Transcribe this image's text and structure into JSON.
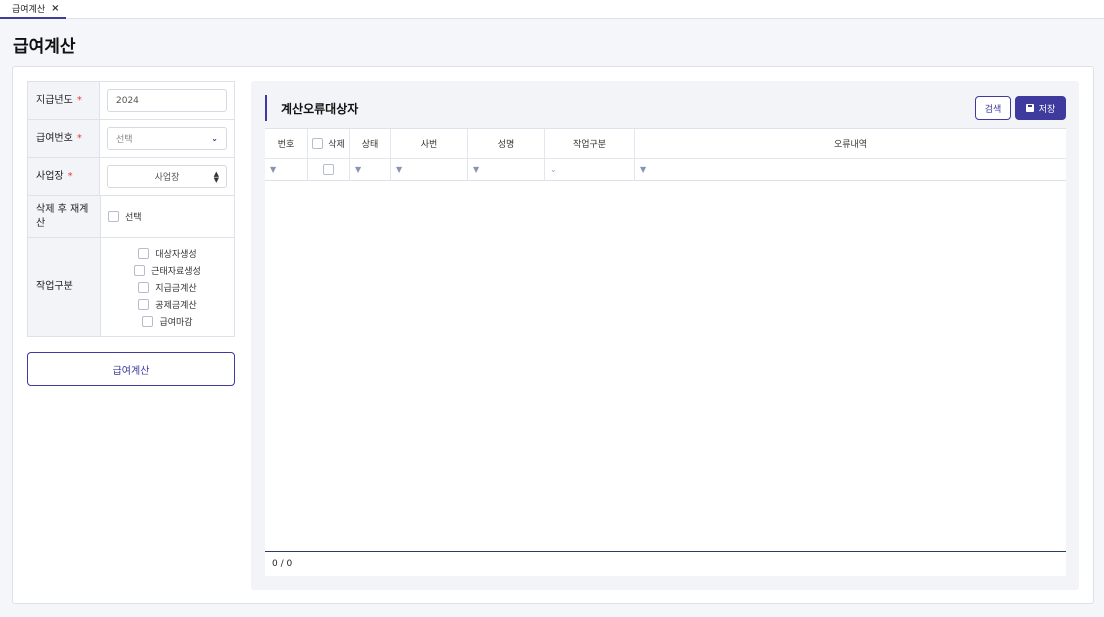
{
  "tabs": [
    {
      "label": "급여계산",
      "close": "×"
    }
  ],
  "page": {
    "title": "급여계산"
  },
  "form": {
    "pay_year": {
      "label": "지급년도",
      "required_mark": "*",
      "value": "2024"
    },
    "pay_number": {
      "label": "급여번호",
      "required_mark": "*",
      "value": "선택"
    },
    "workplace": {
      "label": "사업장",
      "required_mark": "*",
      "value": "사업장"
    },
    "recalc_after_delete": {
      "label": "삭제 후 재계산",
      "option": "선택"
    },
    "job_type": {
      "label": "작업구분",
      "options": [
        "대상자생성",
        "근태자료생성",
        "지급금계산",
        "공제금계산",
        "급여마감"
      ]
    },
    "calculate_button": "급여계산"
  },
  "panel": {
    "title": "계산오류대상자",
    "search_button": "검색",
    "save_button": "저장",
    "columns": [
      "번호",
      "삭제",
      "상태",
      "사번",
      "성명",
      "작업구분",
      "오류내역"
    ],
    "footer": "0 / 0"
  },
  "colors": {
    "accent": "#3e3a9e",
    "required": "#e04040"
  }
}
